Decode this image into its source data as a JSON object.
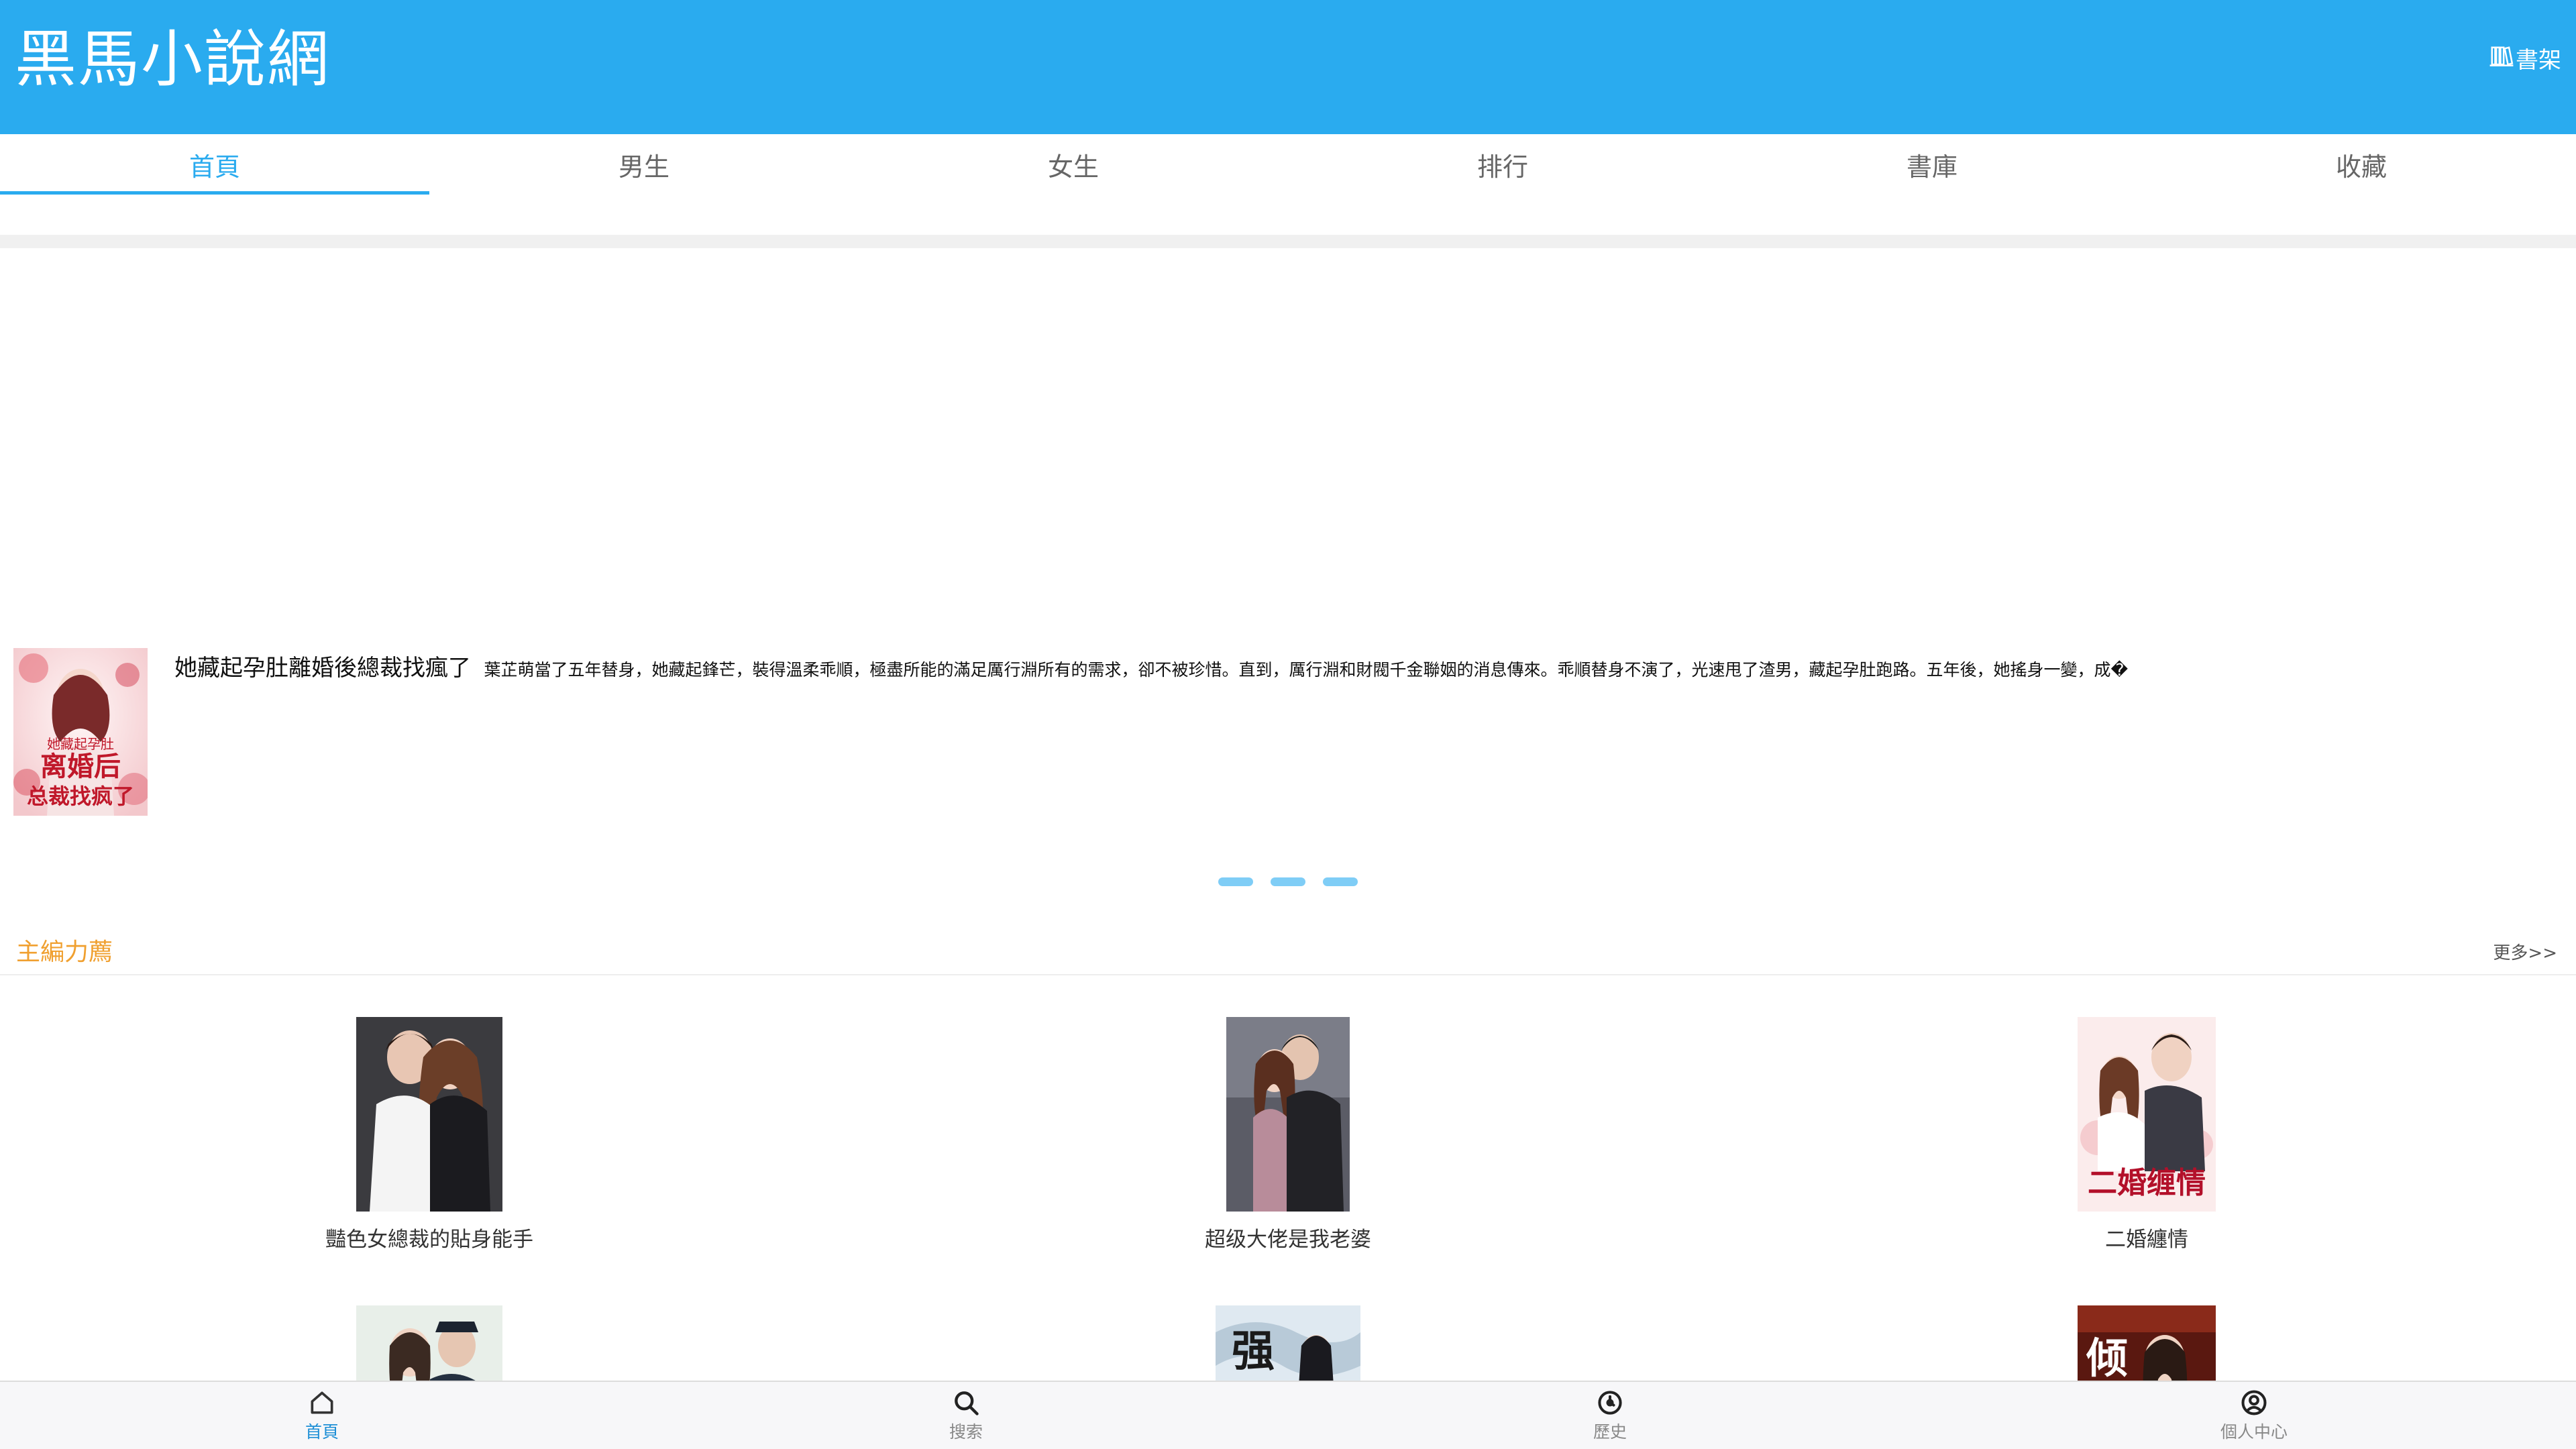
{
  "header": {
    "site_title": "黑馬小說網",
    "shelf_label": "書架",
    "shelf_icon": "book-shelf-icon"
  },
  "tabs": [
    {
      "label": "首頁",
      "active": true
    },
    {
      "label": "男生",
      "active": false
    },
    {
      "label": "女生",
      "active": false
    },
    {
      "label": "排行",
      "active": false
    },
    {
      "label": "書庫",
      "active": false
    },
    {
      "label": "收藏",
      "active": false
    }
  ],
  "carousel": {
    "title": "她藏起孕肚離婚後總裁找瘋了",
    "description": "葉芷萌當了五年替身，她藏起鋒芒，裝得溫柔乖順，極盡所能的滿足厲行淵所有的需求，卻不被珍惜。直到，厲行淵和財閥千金聯姻的消息傳來。乖順替身不演了，光速甩了渣男，藏起孕肚跑路。五年後，她搖身一變，成�",
    "cover_text_line1": "她藏起孕肚",
    "cover_text_line2": "离婚后",
    "cover_text_line3": "总裁找疯了",
    "dot_count": 3
  },
  "section": {
    "title": "主編力薦",
    "more_label": "更多>>"
  },
  "books": [
    {
      "name": "豔色女總裁的貼身能手"
    },
    {
      "name": "超级大佬是我老婆"
    },
    {
      "name": "二婚纏情",
      "cover_text": "二婚缠情"
    },
    {
      "name": ""
    },
    {
      "name": "",
      "cover_text": "强"
    },
    {
      "name": "",
      "cover_text": "倾"
    }
  ],
  "bottom_nav": [
    {
      "label": "首頁",
      "icon": "home-icon",
      "active": true
    },
    {
      "label": "搜索",
      "icon": "search-icon",
      "active": false
    },
    {
      "label": "歷史",
      "icon": "history-icon",
      "active": false
    },
    {
      "label": "個人中心",
      "icon": "user-icon",
      "active": false
    }
  ],
  "colors": {
    "header_bg": "#2aabef",
    "accent": "#2aabef",
    "section_title": "#f0a030",
    "dot": "#7fcdf6"
  }
}
